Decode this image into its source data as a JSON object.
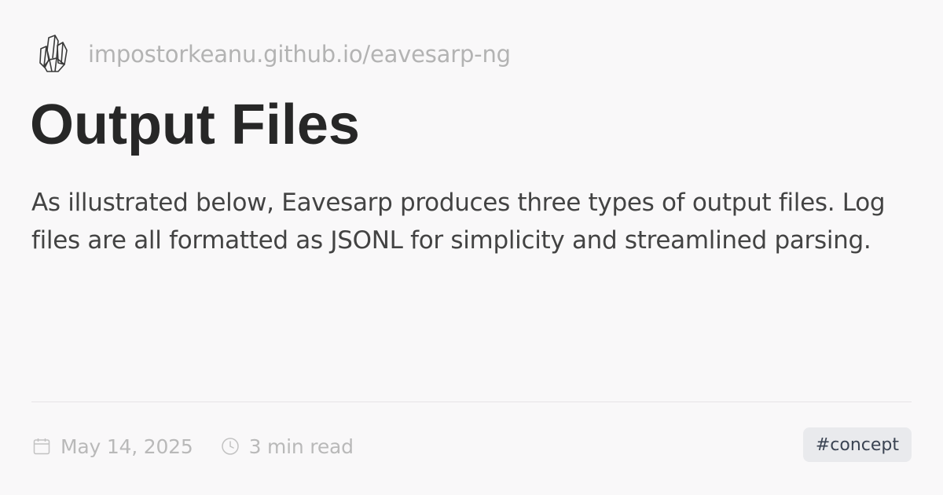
{
  "site": {
    "logo_icon": "crystal-cluster-icon",
    "url": "impostorkeanu.github.io/eavesarp-ng"
  },
  "article": {
    "title": "Output Files",
    "description": "As illustrated below, Eavesarp produces three types of output files. Log files are all formatted as JSONL for simplicity and streamlined parsing."
  },
  "meta": {
    "date_icon": "calendar-icon",
    "date": "May 14, 2025",
    "read_time_icon": "clock-icon",
    "read_time": "3 min read",
    "tag": "#concept"
  },
  "colors": {
    "background": "#f9f8f9",
    "title": "#272727",
    "body_text": "#434343",
    "muted_text": "#b3b3b3",
    "tag_background": "#e9eaed",
    "tag_text": "#3a4352"
  }
}
